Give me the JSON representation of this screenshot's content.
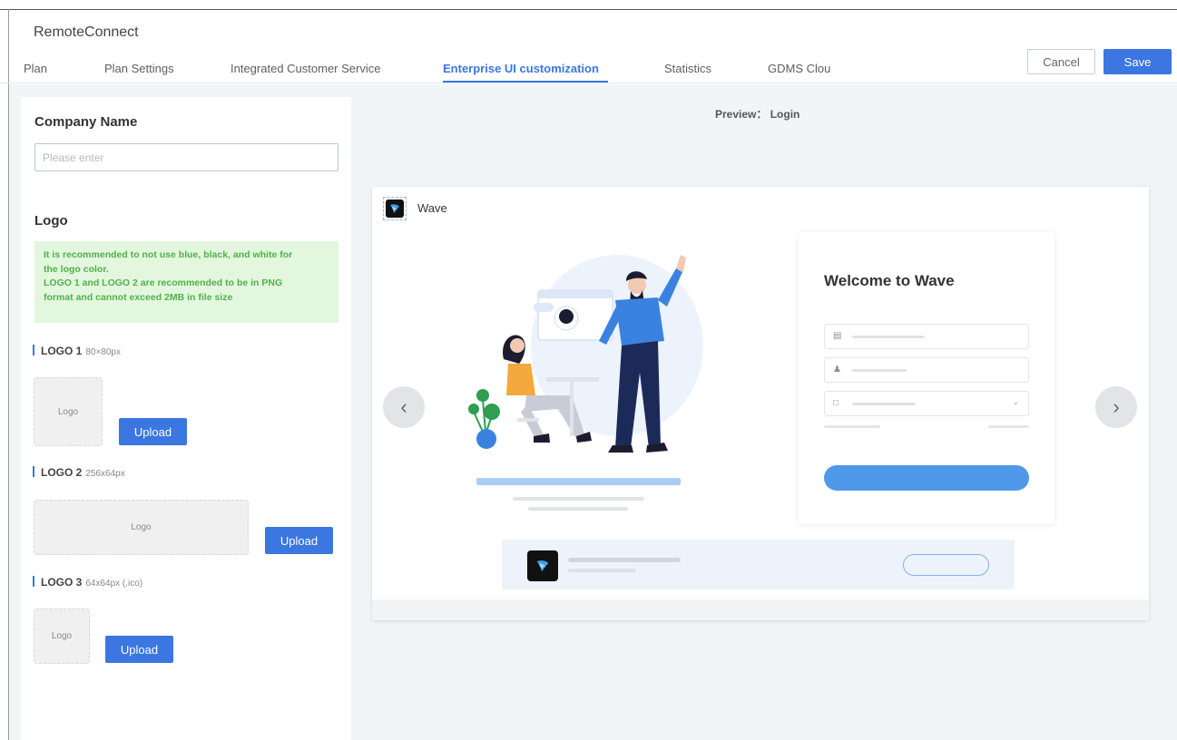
{
  "app": {
    "title": "RemoteConnect"
  },
  "tabs": [
    {
      "label": "Plan",
      "active": false
    },
    {
      "label": "Plan Settings",
      "active": false
    },
    {
      "label": "Integrated Customer Service",
      "active": false
    },
    {
      "label": "Enterprise UI customization",
      "active": true
    },
    {
      "label": "Statistics",
      "active": false
    },
    {
      "label": "GDMS Clou",
      "active": false
    }
  ],
  "actions": {
    "cancel": "Cancel",
    "save": "Save"
  },
  "form": {
    "company_label": "Company Name",
    "company_value": "",
    "company_placeholder": "Please enter",
    "logo_label": "Logo",
    "tip_lines": [
      "It is recommended to not use blue, black, and white for",
      "the logo color.",
      "LOGO 1 and LOGO 2 are recommended to be in PNG",
      "format and cannot exceed 2MB in file size"
    ],
    "logos": [
      {
        "name": "LOGO 1",
        "size": "80×80px",
        "placeholder": "Logo",
        "upload": "Upload"
      },
      {
        "name": "LOGO 2",
        "size": "256x64px",
        "placeholder": "Logo",
        "upload": "Upload"
      },
      {
        "name": "LOGO 3",
        "size": "64x64px (.ico)",
        "placeholder": "Logo",
        "upload": "Upload"
      }
    ]
  },
  "preview": {
    "label": "Preview： Login",
    "brand": "Wave",
    "welcome": "Welcome to Wave"
  },
  "colors": {
    "accent": "#3b76e1",
    "tip_bg": "#e3f7df",
    "tip_text": "#52b04a",
    "login_button": "#4f98ea"
  }
}
